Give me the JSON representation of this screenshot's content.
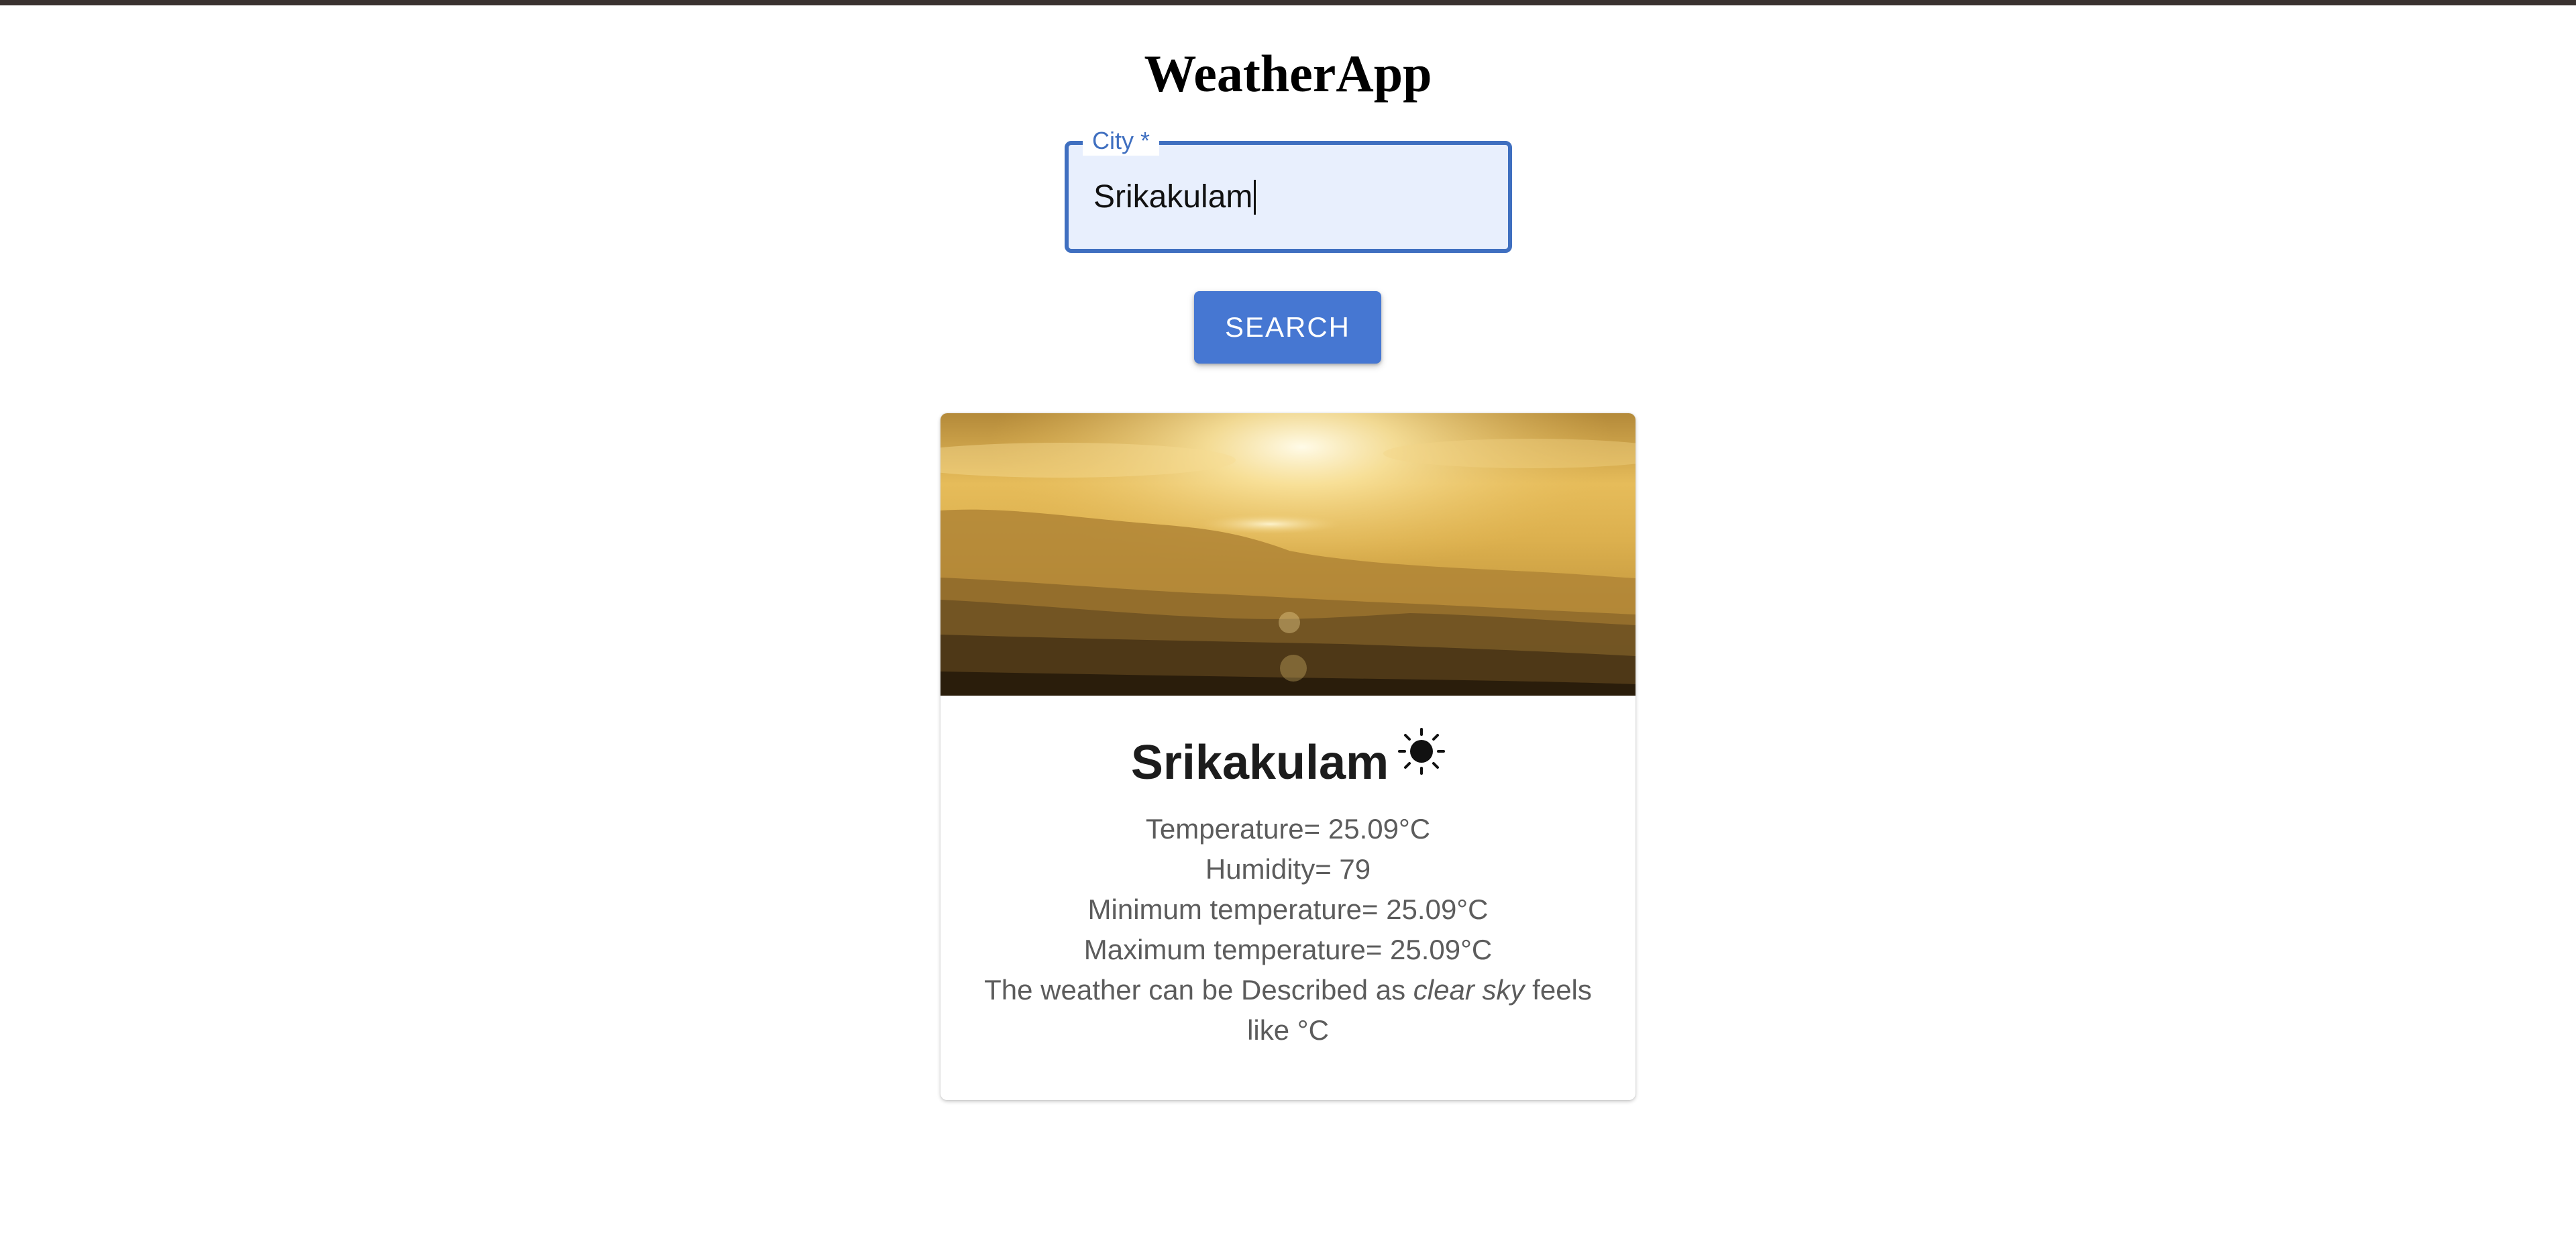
{
  "app": {
    "title": "WeatherApp"
  },
  "search": {
    "label": "City *",
    "value": "Srikakulam",
    "button_label": "SEARCH"
  },
  "result": {
    "city": "Srikakulam",
    "weather_icon": "sun-icon",
    "temperature_line": "Temperature= 25.09°C",
    "humidity_line": "Humidity= 79",
    "min_temp_line": "Minimum temperature= 25.09°C",
    "max_temp_line": "Maximum temperature= 25.09°C",
    "description_prefix": "The weather can be Described as",
    "description": "clear sky",
    "description_suffix_1": "feels",
    "description_suffix_2": "like °C"
  },
  "colors": {
    "accent": "#4677d2",
    "field_border": "#3f6fc0",
    "field_fill": "#e8effd"
  }
}
